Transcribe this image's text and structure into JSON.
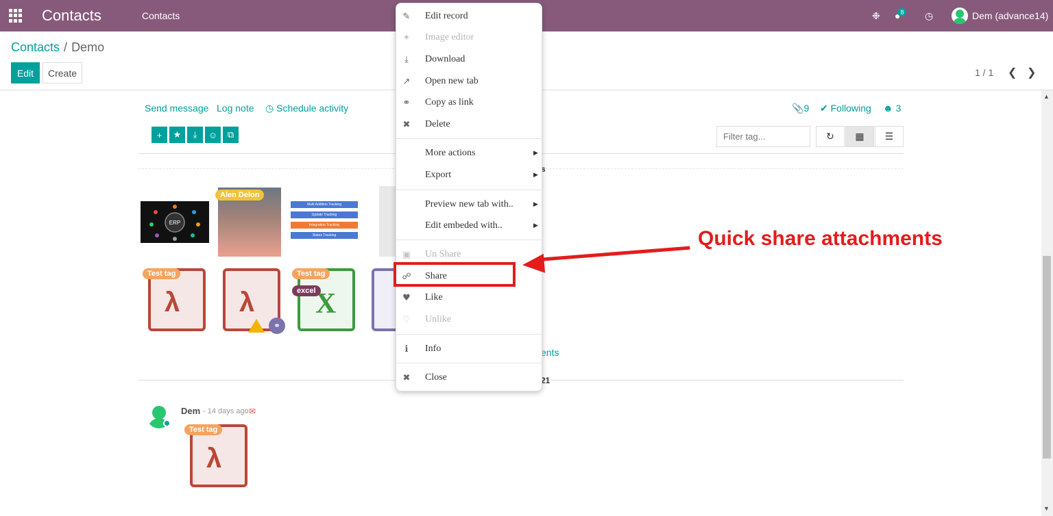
{
  "navbar": {
    "brand": "Contacts",
    "menu_item": "Contacts",
    "chat_badge": "8",
    "user_name": "Dem (advance14)",
    "color": "#875a7b"
  },
  "control_panel": {
    "breadcrumb_parent": "Contacts",
    "breadcrumb_separator": "/",
    "breadcrumb_current": "Demo",
    "edit_label": "Edit",
    "create_label": "Create",
    "pager_value": "1 / 1"
  },
  "chatter": {
    "send_message": "Send message",
    "log_note": "Log note",
    "schedule_activity": "Schedule activity",
    "attachment_count": "9",
    "following_label": "Following",
    "follower_count": "3",
    "filter_placeholder": "Filter tag...",
    "partial_header": "s",
    "partial_link": "ents",
    "partial_date": "21",
    "accent_color": "#00a09d"
  },
  "thumbnails": {
    "erp_label": "ERP",
    "photo_tag": "Alen Delon",
    "bar_labels": [
      "Multi Addition Tracking",
      "Update Tracking",
      "Integration Tracking",
      "Status Tracking"
    ]
  },
  "file_icons": {
    "tag_test": "Test tag",
    "tag_excel": "excel",
    "excel_letter": "X"
  },
  "message": {
    "author": "Dem",
    "date": "- 14 days ago",
    "tag": "Test tag"
  },
  "context_menu": {
    "items": [
      {
        "label": "Edit record",
        "icon": "edit-icon",
        "disabled": false
      },
      {
        "label": "Image editor",
        "icon": "magic-wand-icon",
        "disabled": true
      },
      {
        "label": "Download",
        "icon": "download-icon",
        "disabled": false
      },
      {
        "label": "Open new tab",
        "icon": "external-link-icon",
        "disabled": false
      },
      {
        "label": "Copy as link",
        "icon": "link-icon",
        "disabled": false
      },
      {
        "label": "Delete",
        "icon": "close-icon",
        "disabled": false
      },
      {
        "label": "More actions",
        "icon": "",
        "disabled": false
      },
      {
        "label": "Export",
        "icon": "",
        "disabled": false
      },
      {
        "label": "Preview new tab with..",
        "icon": "",
        "disabled": false
      },
      {
        "label": "Edit embeded with..",
        "icon": "",
        "disabled": false
      },
      {
        "label": "Un Share",
        "icon": "share-square-icon",
        "disabled": true
      },
      {
        "label": "Share",
        "icon": "share-icon",
        "disabled": false
      },
      {
        "label": "Like",
        "icon": "heart-icon",
        "disabled": false
      },
      {
        "label": "Unlike",
        "icon": "heart-outline-icon",
        "disabled": true
      },
      {
        "label": "Info",
        "icon": "info-icon",
        "disabled": false
      },
      {
        "label": "Close",
        "icon": "close-icon",
        "disabled": false
      }
    ]
  },
  "annotation": {
    "text": "Quick share attachments",
    "color": "#e31c1c"
  }
}
